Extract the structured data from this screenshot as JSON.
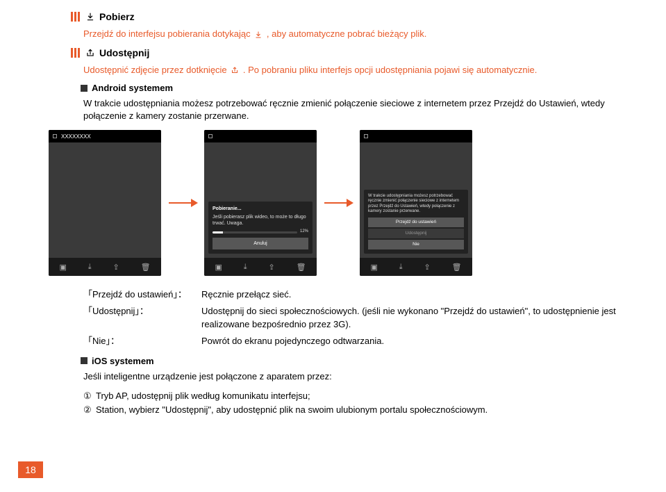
{
  "sections": {
    "download": {
      "title": "Pobierz",
      "para_before": "Przejdź do interfejsu pobierania dotykając ",
      "para_after": " , aby automatyczne pobrać bieżący plik."
    },
    "share": {
      "title": "Udostępnij",
      "para_before": "Udostępnić zdjęcie przez dotknięcie ",
      "para_after": " . Po pobraniu pliku interfejs opcji udostępniania pojawi się automatycznie."
    },
    "android": {
      "title": "Android systemem",
      "body": "W trakcie udostępniania możesz potrzebować ręcznie zmienić połączenie sieciowe z internetem przez Przejdź do Ustawień, wtedy połączenie z kamery zostanie przerwane."
    }
  },
  "phones": {
    "p1_title": "XXXXXXXX",
    "p2": {
      "dl_title": "Pobieranie...",
      "dl_msg": "Jeśli pobierasz plik wideo, to może to długo trwać. Uwaga.",
      "pct": "12%",
      "cancel": "Anuluj"
    },
    "p3": {
      "msg": "W trakcie udostępniania możesz potrzebować ręcznie zmienić połączenie sieciowe z internetem przez Przejdź do Ustawień, wtedy połączenie z kamery zostanie przerwane.",
      "btn1": "Przejdź do ustawień",
      "btn2": "Udostępnij",
      "btn3": "Nie"
    }
  },
  "defs": {
    "r1_term": "「Przejdź do ustawień」：",
    "r1_desc": "Ręcznie przełącz sieć.",
    "r2_term": "「Udostępnij」：",
    "r2_desc": "Udostępnij do sieci społecznościowych. (jeśli nie wykonano \"Przejdź do ustawień\", to udostępnienie jest realizowane bezpośrednio przez 3G).",
    "r3_term": "「Nie」：",
    "r3_desc": "Powrót do ekranu pojedynczego odtwarzania."
  },
  "ios": {
    "title": "iOS systemem",
    "intro": "Jeśli inteligentne urządzenie jest połączone z aparatem przez:",
    "item1": "Tryb AP, udostępnij plik według komunikatu interfejsu;",
    "item2": "Station, wybierz \"Udostępnij\", aby udostępnić plik na swoim ulubionym portalu społecznościowym."
  },
  "page_number": "18"
}
